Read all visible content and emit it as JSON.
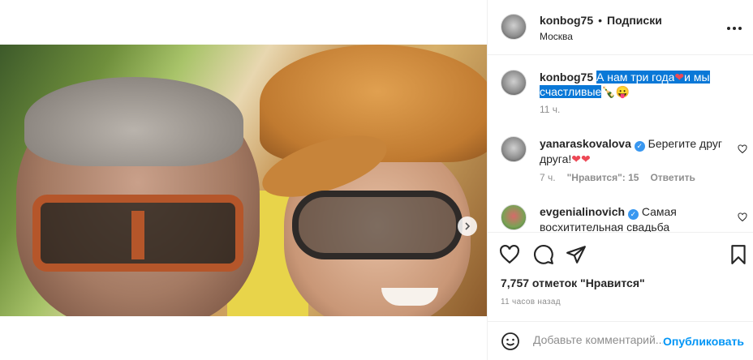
{
  "post": {
    "author": "konbog75",
    "bullet": "•",
    "follow_label": "Подписки",
    "location": "Москва",
    "more_icon": "more-horizontal-icon"
  },
  "caption": {
    "author": "konbog75",
    "text_part1": "А нам три года",
    "heart": "❤",
    "text_part2": "и мы счастливые",
    "emoji_bottle": "🍾",
    "emoji_face": "😛",
    "time": "11 ч."
  },
  "comments": [
    {
      "author": "yanaraskovalova",
      "verified": true,
      "text": "Берегите друг друга!",
      "emoji": "❤❤",
      "time": "7 ч.",
      "likes": "\"Нравится\": 15",
      "reply": "Ответить"
    },
    {
      "author": "evgenialinovich",
      "verified": true,
      "text": "Самая восхитительная свадьба"
    }
  ],
  "actions": {
    "like_icon": "heart-icon",
    "comment_icon": "comment-icon",
    "share_icon": "send-icon",
    "save_icon": "bookmark-icon"
  },
  "likes_text": "7,757 отметок \"Нравится\"",
  "time_ago": "11 часов назад",
  "comment_box": {
    "placeholder": "Добавьте комментарий...",
    "post_label": "Опубликовать"
  },
  "media": {
    "slide_index": 1,
    "slide_count": 2
  },
  "colors": {
    "highlight": "#0a78d7",
    "link_blue": "#0095f6",
    "verified": "#3897f0",
    "heart_red": "#ed4956"
  }
}
